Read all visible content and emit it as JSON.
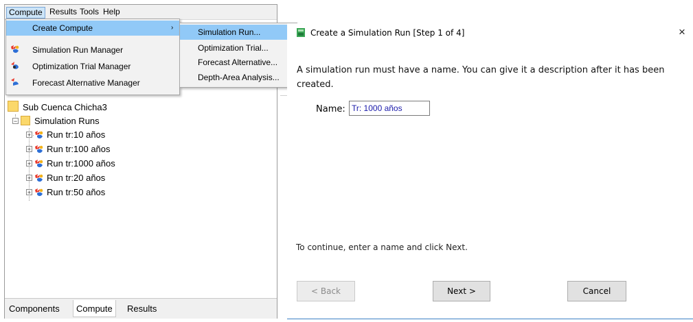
{
  "menubar": {
    "items": [
      "Compute",
      "Results",
      "Tools",
      "Help"
    ]
  },
  "compute_menu": {
    "items": [
      {
        "label": "Create Compute",
        "icon": "none",
        "has_submenu": true
      },
      {
        "label": "Simulation Run Manager",
        "icon": "simulation-run-icon"
      },
      {
        "label": "Optimization Trial Manager",
        "icon": "optimization-trial-icon"
      },
      {
        "label": "Forecast Alternative Manager",
        "icon": "forecast-alternative-icon"
      }
    ]
  },
  "submenu": {
    "items": [
      "Simulation Run...",
      "Optimization Trial...",
      "Forecast Alternative...",
      "Depth-Area Analysis..."
    ]
  },
  "tree": {
    "root": "Sub Cuenca Chicha3",
    "folder": "Simulation Runs",
    "runs": [
      "Run tr:10 años",
      "Run tr:100 años",
      "Run tr:1000 años",
      "Run tr:20 años",
      "Run tr:50 años"
    ]
  },
  "tabs": [
    "Components",
    "Compute",
    "Results"
  ],
  "dialog": {
    "title": "Create a Simulation Run [Step 1 of 4]",
    "close": "×",
    "description_line1": "A simulation run must have a name. You can give it a description after it has been",
    "description_line2": "created.",
    "name_label": "Name:",
    "name_value": "Tr: 1000 años",
    "hint": "To continue, enter a name and click Next.",
    "back_label": "< Back",
    "next_label": "Next >",
    "cancel_label": "Cancel"
  },
  "colors": {
    "menu_highlight": "#91c9f7",
    "folder": "#fbd86b",
    "input_text": "#1a1aaa",
    "accent_line": "#3b7fc4"
  }
}
